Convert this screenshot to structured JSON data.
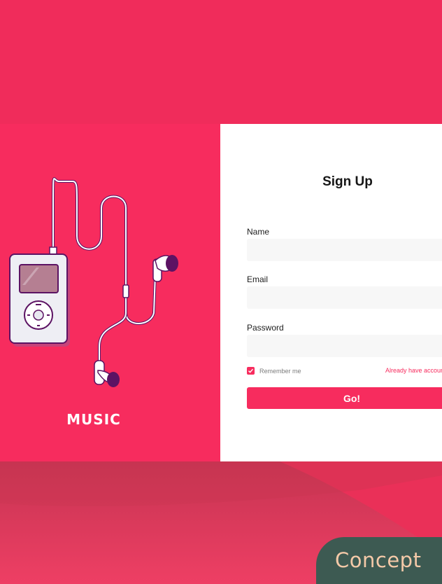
{
  "illustration": {
    "caption": "MUSIC"
  },
  "form": {
    "title": "Sign Up",
    "name_label": "Name",
    "name_value": "",
    "email_label": "Email",
    "email_value": "",
    "password_label": "Password",
    "password_value": "",
    "remember_label": "Remember me",
    "remember_checked": true,
    "signin_link": "Already have account? Sign In",
    "submit_label": "Go!"
  },
  "badge": {
    "label": "Concept"
  },
  "colors": {
    "background": "#f02c5b",
    "accent": "#f72c5e",
    "badge_bg": "#3d5a52",
    "badge_text": "#f4c9a8",
    "earbud": "#5c1363"
  }
}
